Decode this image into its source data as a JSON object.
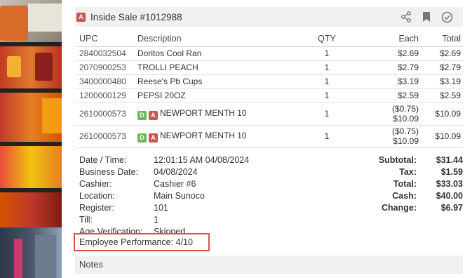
{
  "header": {
    "badge": "A",
    "title": "Inside Sale #1012988"
  },
  "table": {
    "columns": {
      "upc": "UPC",
      "description": "Description",
      "qty": "QTY",
      "each": "Each",
      "total": "Total"
    },
    "rows": [
      {
        "upc": "2840032504",
        "description": "Doritos Cool Ran",
        "qty": "1",
        "each": "$2.69",
        "total": "$2.69"
      },
      {
        "upc": "2070900253",
        "description": "TROLLI PEACH",
        "qty": "1",
        "each": "$2.79",
        "total": "$2.79"
      },
      {
        "upc": "3400000480",
        "description": "Reese's Pb Cups",
        "qty": "1",
        "each": "$3.19",
        "total": "$3.19"
      },
      {
        "upc": "1200000129",
        "description": "PEPSI 20OZ",
        "qty": "1",
        "each": "$2.59",
        "total": "$2.59"
      },
      {
        "upc": "2610000573",
        "badge_d": "D",
        "badge_a": "A",
        "description": "NEWPORT MENTH 10",
        "qty": "1",
        "each_discount": "($0.75)",
        "each": "$10.09",
        "total": "$10.09"
      },
      {
        "upc": "2610000573",
        "badge_d": "D",
        "badge_a": "A",
        "description": "NEWPORT MENTH 10",
        "qty": "1",
        "each_discount": "($0.75)",
        "each": "$10.09",
        "total": "$10.09"
      }
    ]
  },
  "info": [
    {
      "label": "Date / Time:",
      "value": "12:01:15 AM 04/08/2024"
    },
    {
      "label": "Business Date:",
      "value": "04/08/2024"
    },
    {
      "label": "Cashier:",
      "value": "Cashier #6"
    },
    {
      "label": "Location:",
      "value": "Main Sunoco"
    },
    {
      "label": "Register:",
      "value": "101"
    },
    {
      "label": "Till:",
      "value": "1"
    },
    {
      "label": "Age Verification:",
      "value": "Skipped"
    }
  ],
  "totals": [
    {
      "label": "Subtotal:",
      "value": "$31.44"
    },
    {
      "label": "Tax:",
      "value": "$1.59"
    },
    {
      "label": "Total:",
      "value": "$33.03"
    },
    {
      "label": "Cash:",
      "value": "$40.00"
    },
    {
      "label": "Change:",
      "value": "$6.97"
    }
  ],
  "performance": "Employee Performance: 4/10",
  "notes": "Notes",
  "icons": {
    "share": "share-icon",
    "bookmark": "bookmark-icon",
    "check": "check-circle-icon"
  },
  "colors": {
    "badge_a": "#c9574f",
    "badge_d": "#6ab85a",
    "highlight_border": "#d9534f",
    "header_bg": "#f0f0f0"
  }
}
